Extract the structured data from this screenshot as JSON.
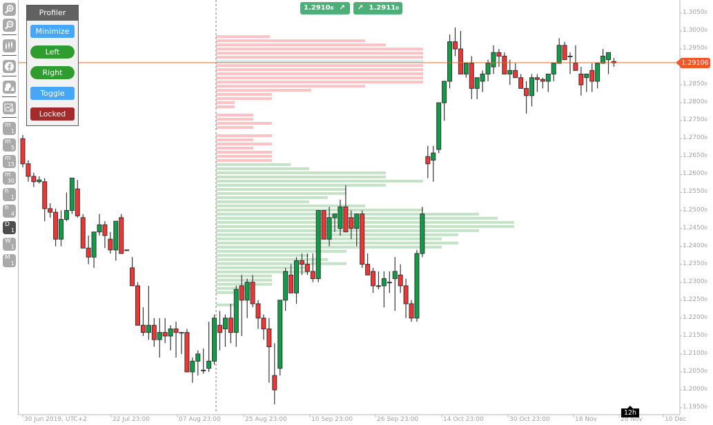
{
  "toolbar": {
    "tools": [
      {
        "name": "zoom-in",
        "icon": "zoom-in-icon"
      },
      {
        "name": "zoom-out",
        "icon": "zoom-out-icon"
      },
      {
        "name": "chart-type",
        "icon": "candlestick-icon"
      },
      {
        "name": "facebook",
        "icon": "facebook-icon"
      },
      {
        "name": "drawing",
        "icon": "shapes-icon"
      },
      {
        "name": "chart-settings",
        "icon": "settings-chart-icon"
      }
    ],
    "timeframes": [
      {
        "t1": "m",
        "t2": "1",
        "active": false
      },
      {
        "t1": "m",
        "t2": "5",
        "active": false
      },
      {
        "t1": "m",
        "t2": "15",
        "active": false
      },
      {
        "t1": "m",
        "t2": "30",
        "active": false
      },
      {
        "t1": "h",
        "t2": "1",
        "active": false
      },
      {
        "t1": "h",
        "t2": "4",
        "active": false
      },
      {
        "t1": "D",
        "t2": "1",
        "active": true
      },
      {
        "t1": "W",
        "t2": "1",
        "active": false
      },
      {
        "t1": "M",
        "t2": "1",
        "active": false
      }
    ]
  },
  "profiler": {
    "title": "Profiler",
    "buttons": [
      "Minimize",
      "Left",
      "Right",
      "Toggle",
      "Locked"
    ]
  },
  "trade": {
    "sell_price": "1.2910",
    "sell_suffix": "6",
    "buy_price": "1.2911",
    "buy_suffix": "0"
  },
  "current_price": "1.29106",
  "timeframe_badge": "12h",
  "colors": {
    "bull": "#0f9d48",
    "bear": "#f03535",
    "profile_above": "#ffc2c4",
    "profile_below": "#c4e3c6",
    "poc": "#c4eefb",
    "price_line": "#e0682a",
    "trade_button": "#4dae78"
  },
  "chart_data": {
    "type": "candlestick",
    "symbol_timezone": "UTC+2",
    "y_ticks": [
      "1.30500",
      "1.30000",
      "1.29500",
      "1.29000",
      "1.28500",
      "1.28000",
      "1.27500",
      "1.27000",
      "1.26500",
      "1.26000",
      "1.25500",
      "1.25000",
      "1.24500",
      "1.24000",
      "1.23500",
      "1.23000",
      "1.22500",
      "1.22000",
      "1.21500",
      "1.21000",
      "1.20500",
      "1.20000",
      "1.19500"
    ],
    "y_range": [
      1.1935,
      1.3085
    ],
    "x_ticks": [
      "30 Jun 2019, UTC+2",
      "22 Jul 23:00",
      "07 Aug 23:00",
      "25 Aug 23:00",
      "10 Sep 23:00",
      "26 Sep 23:00",
      "14 Oct 23:00",
      "30 Oct 23:00",
      "18 Nov",
      "28 Nov",
      "10 Dec"
    ],
    "candles": [
      [
        1.27,
        1.271,
        1.262,
        1.263
      ],
      [
        1.263,
        1.264,
        1.258,
        1.2595
      ],
      [
        1.2595,
        1.2605,
        1.2565,
        1.258
      ],
      [
        1.258,
        1.2595,
        1.2575,
        1.2585
      ],
      [
        1.258,
        1.259,
        1.247,
        1.2505
      ],
      [
        1.2505,
        1.252,
        1.248,
        1.2495
      ],
      [
        1.2495,
        1.2505,
        1.24,
        1.242
      ],
      [
        1.242,
        1.25,
        1.24,
        1.2475
      ],
      [
        1.2475,
        1.255,
        1.247,
        1.25
      ],
      [
        1.25,
        1.259,
        1.249,
        1.259
      ],
      [
        1.256,
        1.2585,
        1.248,
        1.2485
      ],
      [
        1.248,
        1.249,
        1.24,
        1.2395
      ],
      [
        1.2395,
        1.243,
        1.235,
        1.237
      ],
      [
        1.237,
        1.244,
        1.234,
        1.244
      ],
      [
        1.244,
        1.249,
        1.243,
        1.246
      ],
      [
        1.246,
        1.247,
        1.2395,
        1.243
      ],
      [
        1.242,
        1.244,
        1.238,
        1.239
      ],
      [
        1.239,
        1.247,
        1.236,
        1.247
      ],
      [
        1.248,
        1.249,
        1.238,
        1.238
      ],
      [
        1.239,
        1.238,
        1.239,
        1.239
      ],
      [
        1.234,
        1.237,
        1.229,
        1.229
      ],
      [
        1.229,
        1.23,
        1.219,
        1.218
      ],
      [
        1.218,
        1.223,
        1.215,
        1.216
      ],
      [
        1.216,
        1.229,
        1.214,
        1.218
      ],
      [
        1.218,
        1.22,
        1.212,
        1.214
      ],
      [
        1.214,
        1.22,
        1.209,
        1.216
      ],
      [
        1.216,
        1.22,
        1.213,
        1.215
      ],
      [
        1.215,
        1.218,
        1.211,
        1.217
      ],
      [
        1.217,
        1.219,
        1.209,
        1.216
      ],
      [
        1.216,
        1.215,
        1.21,
        1.216
      ],
      [
        1.216,
        1.217,
        1.205,
        1.205
      ],
      [
        1.205,
        1.209,
        1.202,
        1.208
      ],
      [
        1.208,
        1.211,
        1.204,
        1.21
      ],
      [
        1.2055,
        1.2115,
        1.2045,
        1.2055
      ],
      [
        1.206,
        1.219,
        1.205,
        1.208
      ],
      [
        1.208,
        1.221,
        1.207,
        1.22
      ],
      [
        1.218,
        1.222,
        1.211,
        1.216
      ],
      [
        1.217,
        1.221,
        1.212,
        1.22
      ],
      [
        1.22,
        1.224,
        1.213,
        1.216
      ],
      [
        1.216,
        1.229,
        1.212,
        1.228
      ],
      [
        1.229,
        1.232,
        1.215,
        1.225
      ],
      [
        1.225,
        1.231,
        1.22,
        1.23
      ],
      [
        1.23,
        1.232,
        1.223,
        1.224
      ],
      [
        1.224,
        1.225,
        1.217,
        1.22
      ],
      [
        1.22,
        1.221,
        1.214,
        1.217
      ],
      [
        1.217,
        1.22,
        1.202,
        1.212
      ],
      [
        1.204,
        1.213,
        1.196,
        1.2
      ],
      [
        1.206,
        1.223,
        1.204,
        1.225
      ],
      [
        1.225,
        1.234,
        1.222,
        1.233
      ],
      [
        1.232,
        1.235,
        1.228,
        1.227
      ],
      [
        1.227,
        1.237,
        1.224,
        1.236
      ],
      [
        1.236,
        1.238,
        1.232,
        1.235
      ],
      [
        1.235,
        1.238,
        1.232,
        1.233
      ],
      [
        1.233,
        1.238,
        1.23,
        1.231
      ],
      [
        1.231,
        1.25,
        1.23,
        1.25
      ],
      [
        1.25,
        1.25,
        1.242,
        1.242
      ],
      [
        1.242,
        1.251,
        1.24,
        1.248
      ],
      [
        1.248,
        1.249,
        1.244,
        1.249
      ],
      [
        1.245,
        1.253,
        1.243,
        1.251
      ],
      [
        1.251,
        1.257,
        1.247,
        1.244
      ],
      [
        1.248,
        1.25,
        1.242,
        1.245
      ],
      [
        1.245,
        1.249,
        1.24,
        1.249
      ],
      [
        1.249,
        1.25,
        1.234,
        1.235
      ],
      [
        1.235,
        1.238,
        1.232,
        1.232
      ],
      [
        1.233,
        1.234,
        1.227,
        1.229
      ],
      [
        1.229,
        1.233,
        1.228,
        1.229
      ],
      [
        1.229,
        1.233,
        1.223,
        1.231
      ],
      [
        1.23,
        1.233,
        1.227,
        1.23
      ],
      [
        1.231,
        1.237,
        1.222,
        1.233
      ],
      [
        1.232,
        1.235,
        1.227,
        1.229
      ],
      [
        1.229,
        1.231,
        1.22,
        1.224
      ],
      [
        1.224,
        1.225,
        1.219,
        1.22
      ],
      [
        1.22,
        1.239,
        1.219,
        1.238
      ],
      [
        1.238,
        1.251,
        1.237,
        1.249
      ],
      [
        1.265,
        1.268,
        1.259,
        1.263
      ],
      [
        1.264,
        1.268,
        1.258,
        1.266
      ],
      [
        1.267,
        1.279,
        1.266,
        1.28
      ],
      [
        1.28,
        1.286,
        1.275,
        1.286
      ],
      [
        1.286,
        1.299,
        1.284,
        1.297
      ],
      [
        1.297,
        1.301,
        1.293,
        1.295
      ],
      [
        1.295,
        1.3,
        1.288,
        1.288
      ],
      [
        1.288,
        1.291,
        1.287,
        1.291
      ],
      [
        1.291,
        1.293,
        1.281,
        1.284
      ],
      [
        1.284,
        1.287,
        1.281,
        1.287
      ],
      [
        1.286,
        1.289,
        1.283,
        1.288
      ],
      [
        1.288,
        1.292,
        1.286,
        1.291
      ],
      [
        1.29,
        1.296,
        1.288,
        1.294
      ],
      [
        1.294,
        1.295,
        1.29,
        1.293
      ],
      [
        1.293,
        1.294,
        1.288,
        1.288
      ],
      [
        1.288,
        1.292,
        1.285,
        1.289
      ],
      [
        1.289,
        1.291,
        1.287,
        1.287
      ],
      [
        1.287,
        1.288,
        1.284,
        1.284
      ],
      [
        1.284,
        1.286,
        1.277,
        1.282
      ],
      [
        1.282,
        1.288,
        1.279,
        1.287
      ],
      [
        1.287,
        1.288,
        1.283,
        1.2865
      ],
      [
        1.2865,
        1.287,
        1.284,
        1.286
      ],
      [
        1.286,
        1.287,
        1.283,
        1.288
      ],
      [
        1.288,
        1.29,
        1.286,
        1.291
      ],
      [
        1.291,
        1.298,
        1.291,
        1.296
      ],
      [
        1.296,
        1.297,
        1.292,
        1.292
      ],
      [
        1.293,
        1.294,
        1.288,
        1.293
      ],
      [
        1.291,
        1.296,
        1.289,
        1.289
      ],
      [
        1.288,
        1.29,
        1.282,
        1.285
      ],
      [
        1.287,
        1.288,
        1.283,
        1.288
      ],
      [
        1.289,
        1.291,
        1.283,
        1.286
      ],
      [
        1.286,
        1.291,
        1.284,
        1.291
      ],
      [
        1.291,
        1.295,
        1.291,
        1.293
      ],
      [
        1.292,
        1.294,
        1.288,
        1.294
      ],
      [
        1.2915,
        1.2925,
        1.29,
        1.2911
      ]
    ],
    "profile": {
      "start_price_top": 1.299,
      "step": 0.00115,
      "rows": [
        {
          "v": 0.26,
          "z": "a"
        },
        {
          "v": 0.72,
          "z": "a"
        },
        {
          "v": 0.82,
          "z": "a"
        },
        {
          "v": 1.0,
          "z": "a"
        },
        {
          "v": 1.0,
          "z": "a"
        },
        {
          "v": 1.0,
          "z": "a"
        },
        {
          "v": 1.0,
          "z": "poc"
        },
        {
          "v": 1.0,
          "z": "a"
        },
        {
          "v": 1.0,
          "z": "a"
        },
        {
          "v": 1.0,
          "z": "a"
        },
        {
          "v": 1.0,
          "z": "a"
        },
        {
          "v": 1.0,
          "z": "a"
        },
        {
          "v": 0.72,
          "z": "a"
        },
        {
          "v": 0.46,
          "z": "a"
        },
        {
          "v": 0.27,
          "z": "a"
        },
        {
          "v": 0.27,
          "z": "a"
        },
        {
          "v": 0.09,
          "z": "a"
        },
        {
          "v": 0.09,
          "z": "a"
        },
        {
          "v": 0,
          "z": "a"
        },
        {
          "v": 0.18,
          "z": "a"
        },
        {
          "v": 0.18,
          "z": "a"
        },
        {
          "v": 0.27,
          "z": "a"
        },
        {
          "v": 0.18,
          "z": "a"
        },
        {
          "v": 0,
          "z": "a"
        },
        {
          "v": 0.27,
          "z": "a"
        },
        {
          "v": 0.18,
          "z": "a"
        },
        {
          "v": 0.27,
          "z": "a"
        },
        {
          "v": 0.18,
          "z": "a"
        },
        {
          "v": 0.27,
          "z": "a"
        },
        {
          "v": 0.27,
          "z": "a"
        },
        {
          "v": 0.27,
          "z": "a"
        },
        {
          "v": 0.36,
          "z": "b"
        },
        {
          "v": 0.45,
          "z": "b"
        },
        {
          "v": 0.82,
          "z": "b"
        },
        {
          "v": 0.82,
          "z": "b"
        },
        {
          "v": 1.0,
          "z": "b"
        },
        {
          "v": 0.82,
          "z": "b"
        },
        {
          "v": 0.63,
          "z": "b"
        },
        {
          "v": 0.63,
          "z": "b"
        },
        {
          "v": 0.54,
          "z": "b"
        },
        {
          "v": 0.45,
          "z": "b"
        },
        {
          "v": 0.72,
          "z": "b"
        },
        {
          "v": 1.0,
          "z": "b"
        },
        {
          "v": 1.27,
          "z": "b"
        },
        {
          "v": 1.36,
          "z": "b"
        },
        {
          "v": 1.44,
          "z": "b"
        },
        {
          "v": 1.44,
          "z": "b"
        },
        {
          "v": 1.27,
          "z": "b"
        },
        {
          "v": 1.17,
          "z": "b"
        },
        {
          "v": 1.09,
          "z": "b"
        },
        {
          "v": 1.17,
          "z": "b"
        },
        {
          "v": 1.09,
          "z": "b"
        },
        {
          "v": 0.63,
          "z": "b"
        },
        {
          "v": 0.45,
          "z": "b"
        },
        {
          "v": 0.54,
          "z": "b"
        },
        {
          "v": 0.63,
          "z": "b"
        },
        {
          "v": 0.45,
          "z": "b"
        },
        {
          "v": 0.45,
          "z": "b"
        },
        {
          "v": 0.27,
          "z": "b"
        },
        {
          "v": 0.27,
          "z": "b"
        },
        {
          "v": 0.27,
          "z": "b"
        },
        {
          "v": 0.18,
          "z": "b"
        },
        {
          "v": 0.09,
          "z": "b"
        },
        {
          "v": 0,
          "z": "b"
        },
        {
          "v": 0,
          "z": "b"
        },
        {
          "v": 0.09,
          "z": "b"
        }
      ]
    }
  }
}
